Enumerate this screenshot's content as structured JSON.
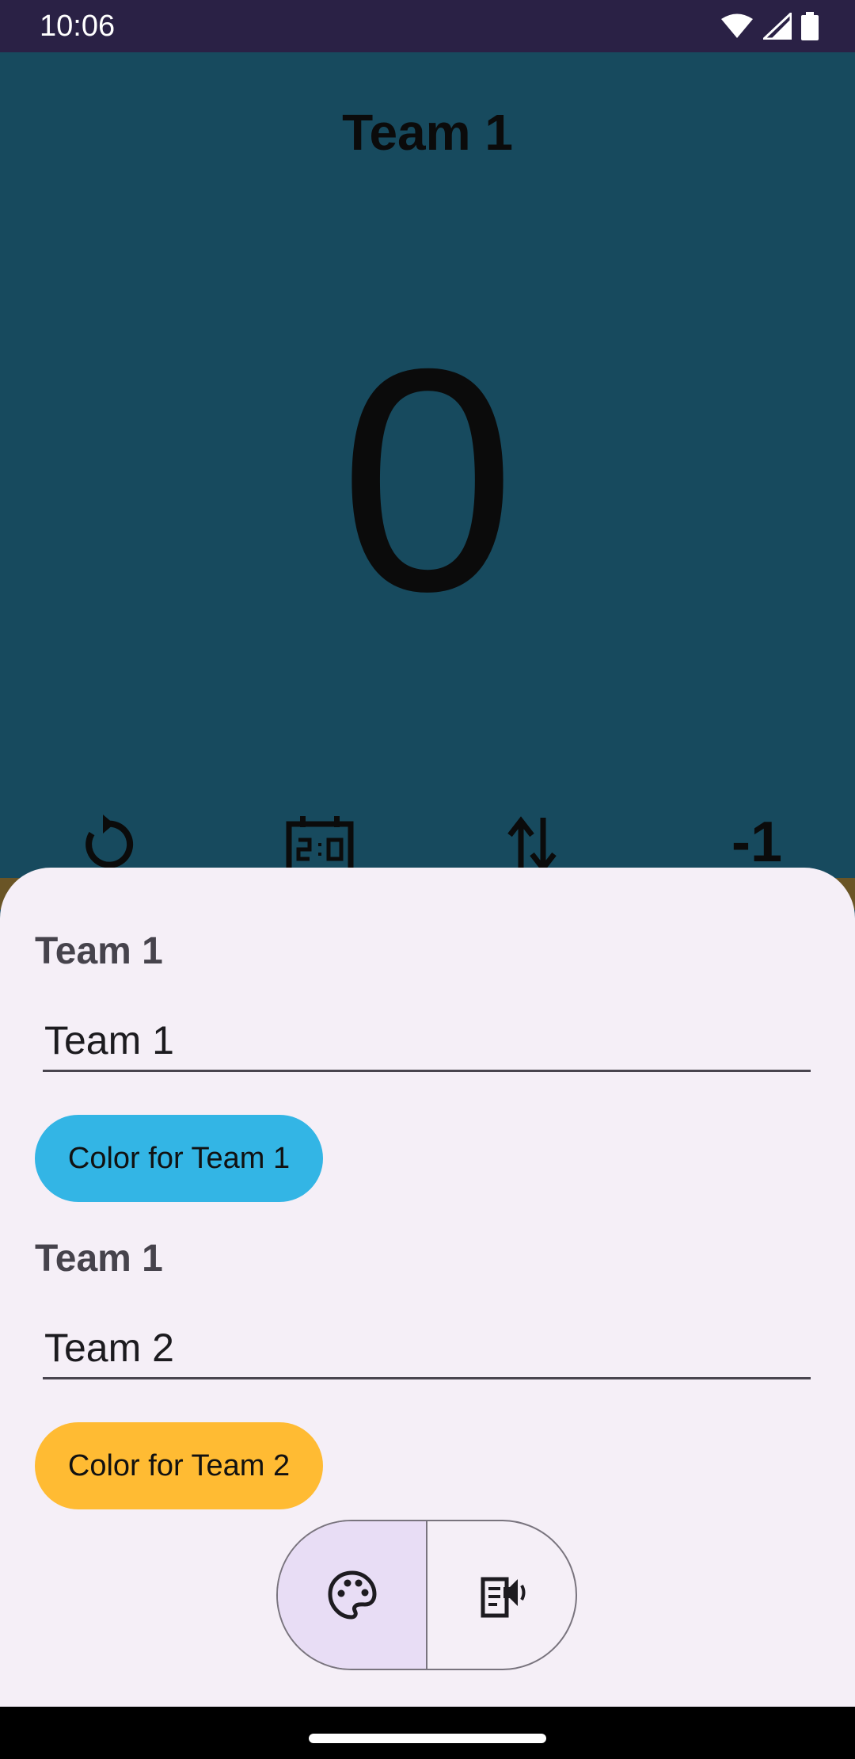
{
  "status_bar": {
    "time": "10:06",
    "icons": [
      "wifi-icon",
      "signal-icon",
      "battery-icon"
    ]
  },
  "team_panel": {
    "title": "Team 1",
    "score": "0",
    "background_color": "#174a5e",
    "actions": {
      "reset_icon": "reset-icon",
      "scoreboard_icon": "scoreboard-icon",
      "swap_icon": "swap-icon",
      "minus_one_label": "-1"
    }
  },
  "sheet": {
    "team1": {
      "section_label": "Team 1",
      "name_value": "Team 1",
      "color_button_label": "Color for Team 1",
      "color": "#33b5e5"
    },
    "team2": {
      "section_label": "Team 1",
      "name_value": "Team 2",
      "color_button_label": "Color for Team 2",
      "color": "#ffbb33"
    },
    "segments": {
      "selected": "color",
      "items": [
        "palette-icon",
        "speech-icon"
      ]
    }
  }
}
